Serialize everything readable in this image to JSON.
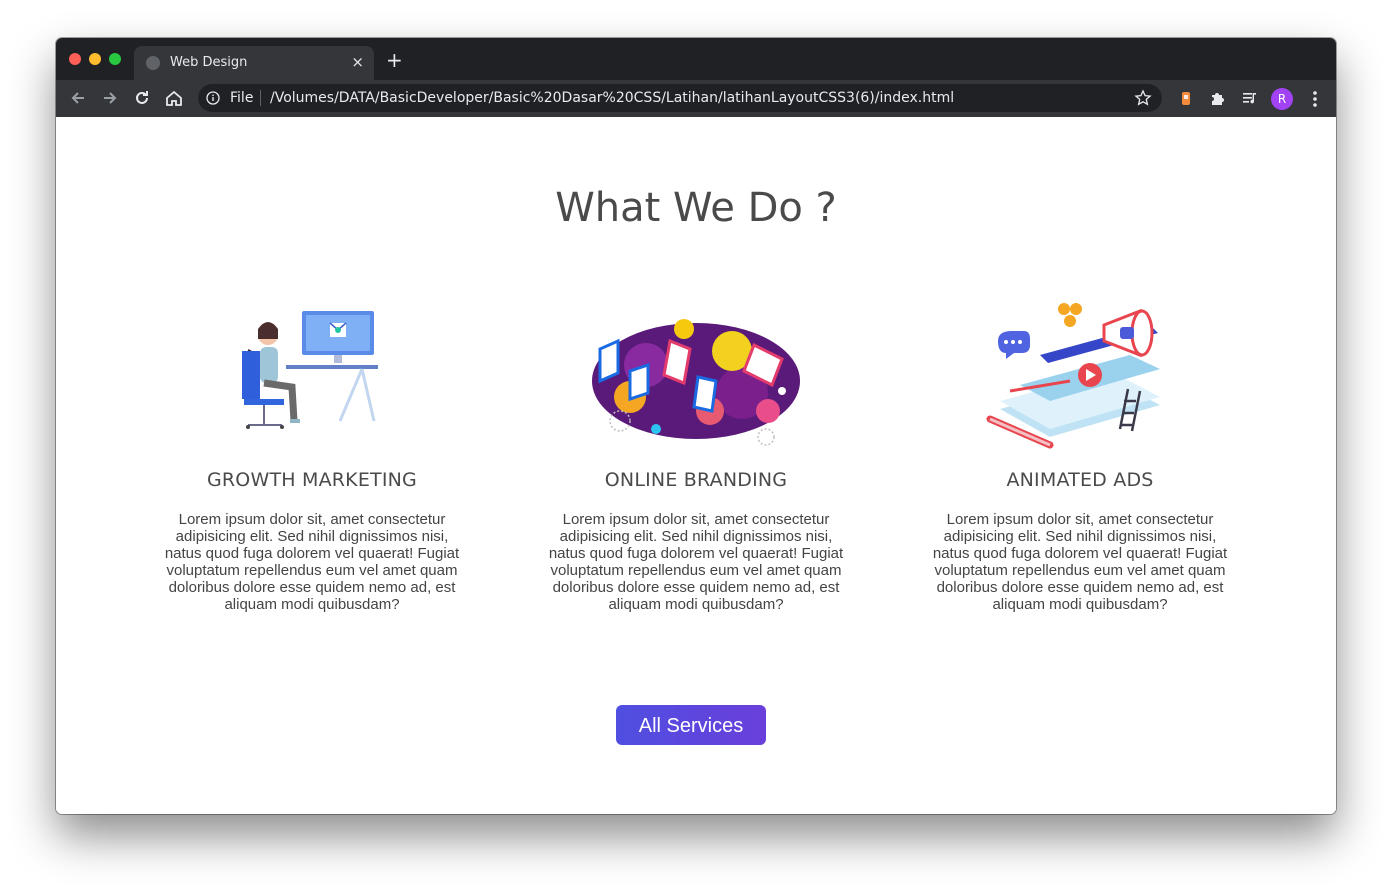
{
  "browser": {
    "tab_title": "Web Design",
    "tab_close": "×",
    "new_tab": "+",
    "scheme_label": "File",
    "url": "/Volumes/DATA/BasicDeveloper/Basic%20Dasar%20CSS/Latihan/latihanLayoutCSS3(6)/index.html",
    "avatar_letter": "R"
  },
  "section": {
    "title": "What We Do ?",
    "services": [
      {
        "title": "GROWTH MARKETING",
        "description": "Lorem ipsum dolor sit, amet consectetur adipisicing elit. Sed nihil dignissimos nisi, natus quod fuga dolorem vel quaerat! Fugiat voluptatum repellendus eum vel amet quam doloribus dolore esse quidem nemo ad, est aliquam modi quibusdam?",
        "icon": "person-at-desk-illustration"
      },
      {
        "title": "ONLINE BRANDING",
        "description": "Lorem ipsum dolor sit, amet consectetur adipisicing elit. Sed nihil dignissimos nisi, natus quod fuga dolorem vel quaerat! Fugiat voluptatum repellendus eum vel amet quam doloribus dolore esse quidem nemo ad, est aliquam modi quibusdam?",
        "icon": "brand-lettering-illustration"
      },
      {
        "title": "ANIMATED ADS",
        "description": "Lorem ipsum dolor sit, amet consectetur adipisicing elit. Sed nihil dignissimos nisi, natus quod fuga dolorem vel quaerat! Fugiat voluptatum repellendus eum vel amet quam doloribus dolore esse quidem nemo ad, est aliquam modi quibusdam?",
        "icon": "megaphone-ads-illustration"
      }
    ],
    "button_label": "All Services"
  },
  "colors": {
    "button": "#5a48de",
    "heading": "#4a4a4a",
    "chrome_dark": "#202124"
  }
}
